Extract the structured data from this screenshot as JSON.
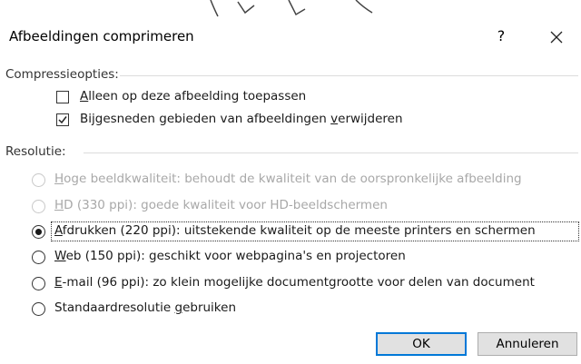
{
  "dialog": {
    "title": "Afbeeldingen comprimeren",
    "help_label": "?",
    "close_icon": "close-icon"
  },
  "compression": {
    "heading": "Compressieopties:",
    "options": [
      {
        "pre": "",
        "key": "A",
        "post": "lleen op deze afbeelding toepassen",
        "checked": false
      },
      {
        "pre": "Bijgesneden gebieden van afbeeldingen ",
        "key": "v",
        "post": "erwijderen",
        "checked": true
      }
    ]
  },
  "resolution": {
    "heading": "Resolutie:",
    "options": [
      {
        "pre": "",
        "key": "H",
        "post": "oge beeldkwaliteit: behoudt de kwaliteit van de oorspronkelijke afbeelding",
        "selected": false,
        "enabled": false
      },
      {
        "pre": "",
        "key": "H",
        "post": "D (330 ppi): goede kwaliteit voor HD-beeldschermen",
        "selected": false,
        "enabled": false
      },
      {
        "pre": "",
        "key": "A",
        "post": "fdrukken (220 ppi): uitstekende kwaliteit op de meeste printers en schermen",
        "selected": true,
        "enabled": true
      },
      {
        "pre": "",
        "key": "W",
        "post": "eb (150 ppi): geschikt voor webpagina's en projectoren",
        "selected": false,
        "enabled": true
      },
      {
        "pre": "",
        "key": "E",
        "post": "-mail (96 ppi): zo klein mogelijke documentgrootte voor delen van document",
        "selected": false,
        "enabled": true
      },
      {
        "pre": "Standaardresolutie ",
        "key": "g",
        "post": "ebruiken",
        "selected": false,
        "enabled": true
      }
    ]
  },
  "buttons": {
    "ok": "OK",
    "cancel": "Annuleren"
  }
}
